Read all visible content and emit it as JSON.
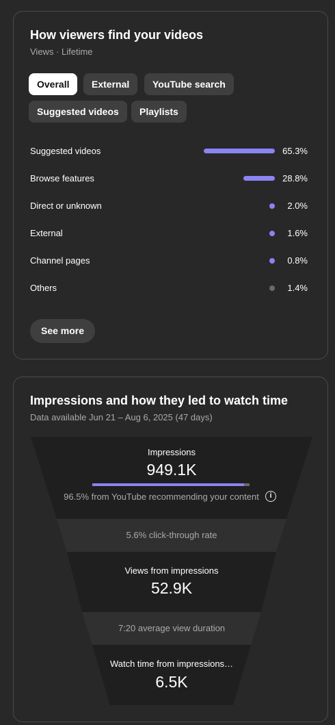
{
  "traffic": {
    "title": "How viewers find your videos",
    "subtitle": "Views · Lifetime",
    "tabs": [
      {
        "label": "Overall",
        "active": true
      },
      {
        "label": "External",
        "active": false
      },
      {
        "label": "YouTube search",
        "active": false
      },
      {
        "label": "Suggested videos",
        "active": false
      },
      {
        "label": "Playlists",
        "active": false
      }
    ],
    "sources": [
      {
        "label": "Suggested videos",
        "percent_text": "65.3%",
        "share": 0.653
      },
      {
        "label": "Browse features",
        "percent_text": "28.8%",
        "share": 0.288
      },
      {
        "label": "Direct or unknown",
        "percent_text": "2.0%",
        "share": 0.02
      },
      {
        "label": "External",
        "percent_text": "1.6%",
        "share": 0.016
      },
      {
        "label": "Channel pages",
        "percent_text": "0.8%",
        "share": 0.008
      },
      {
        "label": "Others",
        "percent_text": "1.4%",
        "share": 0.014
      }
    ],
    "see_more_label": "See more",
    "accent_color": "#8b84f3",
    "others_color": "#6a6a6a"
  },
  "impressions": {
    "title": "Impressions and how they led to watch time",
    "subtitle": "Data available Jun 21 – Aug 6, 2025 (47 days)",
    "impressions_label": "Impressions",
    "impressions_value": "949.1K",
    "recommend_note": "96.5% from YouTube recommending your content",
    "recommend_share": 0.965,
    "ctr_note": "5.6% click-through rate",
    "views_label": "Views from impressions",
    "views_value": "52.9K",
    "duration_note": "7:20 average view duration",
    "watch_label": "Watch time from impressions…",
    "watch_value": "6.5K",
    "info_icon": "info-icon"
  }
}
